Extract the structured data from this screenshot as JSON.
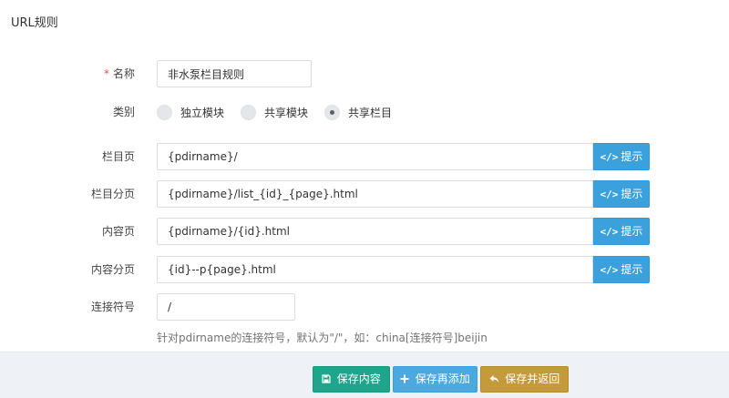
{
  "title": "URL规则",
  "form": {
    "name": {
      "label": "名称",
      "required_mark": "*",
      "value": "非水泵栏目规则"
    },
    "category": {
      "label": "类别",
      "options": [
        "独立模块",
        "共享模块",
        "共享栏目"
      ],
      "selected_index": 2
    },
    "list_page": {
      "label": "栏目页",
      "value": "{pdirname}/"
    },
    "list_paged": {
      "label": "栏目分页",
      "value": "{pdirname}/list_{id}_{page}.html"
    },
    "content_page": {
      "label": "内容页",
      "value": "{pdirname}/{id}.html"
    },
    "content_paged": {
      "label": "内容分页",
      "value": "{id}--p{page}.html"
    },
    "separator": {
      "label": "连接符号",
      "value": "/",
      "help": "针对pdirname的连接符号，默认为\"/\"，如：china[连接符号]beijin"
    },
    "hint_button": {
      "icon": "code-icon",
      "glyph": "</>",
      "label": "提示"
    }
  },
  "footer": {
    "save": {
      "icon": "save-icon",
      "label": "保存内容"
    },
    "save_add": {
      "icon": "plus-icon",
      "label": "保存再添加"
    },
    "save_return": {
      "icon": "reply-icon",
      "label": "保存并返回"
    }
  },
  "colors": {
    "hint": "#3ba1dd",
    "save": "#1ea58b",
    "save_add": "#4ba9e0",
    "save_return": "#c59a3a",
    "required": "#e7505a"
  }
}
